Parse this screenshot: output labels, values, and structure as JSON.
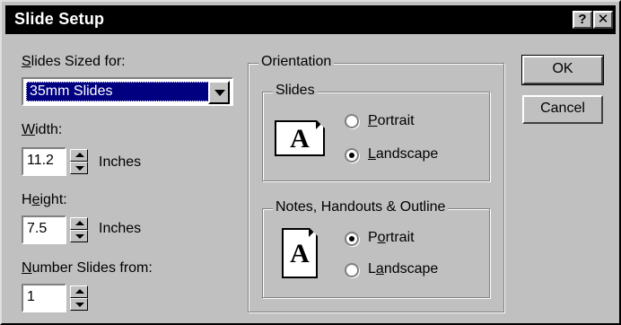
{
  "window": {
    "title": "Slide Setup",
    "help_button": "?",
    "close_button": "✕"
  },
  "slides_sized_for": {
    "label_prefix": "",
    "label_access": "S",
    "label_rest": "lides Sized for:",
    "value": "35mm Slides"
  },
  "width": {
    "label_access": "W",
    "label_rest": "idth:",
    "value": "11.2",
    "unit": "Inches"
  },
  "height": {
    "label_pre": "H",
    "label_access": "e",
    "label_rest": "ight:",
    "value": "7.5",
    "unit": "Inches"
  },
  "number_slides_from": {
    "label_access": "N",
    "label_rest": "umber Slides from:",
    "value": "1"
  },
  "orientation": {
    "label": "Orientation",
    "slides": {
      "label": "Slides",
      "icon_glyph": "A",
      "portrait_access": "P",
      "portrait_rest": "ortrait",
      "landscape_access": "L",
      "landscape_rest": "andscape",
      "selected": "Landscape"
    },
    "notes": {
      "label": "Notes, Handouts & Outline",
      "icon_glyph": "A",
      "portrait_access": "o",
      "portrait_pre": "P",
      "portrait_rest": "rtrait",
      "landscape_access": "a",
      "landscape_pre": "L",
      "landscape_rest": "ndscape",
      "selected": "Portrait"
    }
  },
  "buttons": {
    "ok": "OK",
    "cancel": "Cancel"
  }
}
